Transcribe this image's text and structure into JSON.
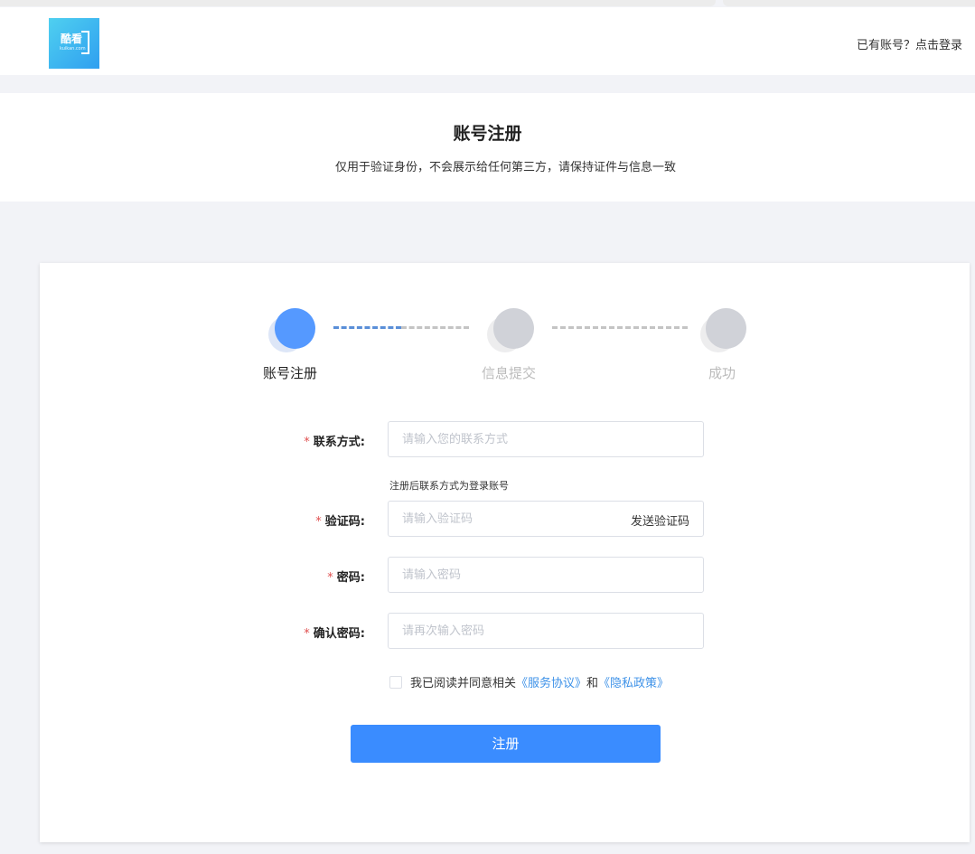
{
  "header": {
    "logo_text": "酷看",
    "logo_sub": "kuikan.com",
    "login_link": "已有账号？点击登录"
  },
  "banner": {
    "title": "账号注册",
    "subtitle": "仅用于验证身份，不会展示给任何第三方，请保持证件与信息一致"
  },
  "steps": [
    {
      "label": "账号注册",
      "state": "active"
    },
    {
      "label": "信息提交",
      "state": "pending"
    },
    {
      "label": "成功",
      "state": "pending"
    }
  ],
  "form": {
    "required_mark": "*",
    "contact": {
      "label": "联系方式:",
      "placeholder": "请输入您的联系方式",
      "value": ""
    },
    "contact_hint": "注册后联系方式为登录账号",
    "code": {
      "label": "验证码:",
      "placeholder": "请输入验证码",
      "value": "",
      "send_label": "发送验证码"
    },
    "password": {
      "label": "密码:",
      "placeholder": "请输入密码",
      "value": ""
    },
    "confirm": {
      "label": "确认密码:",
      "placeholder": "请再次输入密码",
      "value": ""
    },
    "agreement": {
      "checked": false,
      "prefix": "我已阅读并同意相关",
      "service_link": "《服务协议》",
      "and": "和",
      "privacy_link": "《隐私政策》"
    },
    "submit_label": "注册"
  },
  "colors": {
    "primary": "#3a8cff",
    "step_active": "#5599ff",
    "step_inactive": "#d0d2d8",
    "link": "#3e92e8",
    "required": "#e05050"
  }
}
